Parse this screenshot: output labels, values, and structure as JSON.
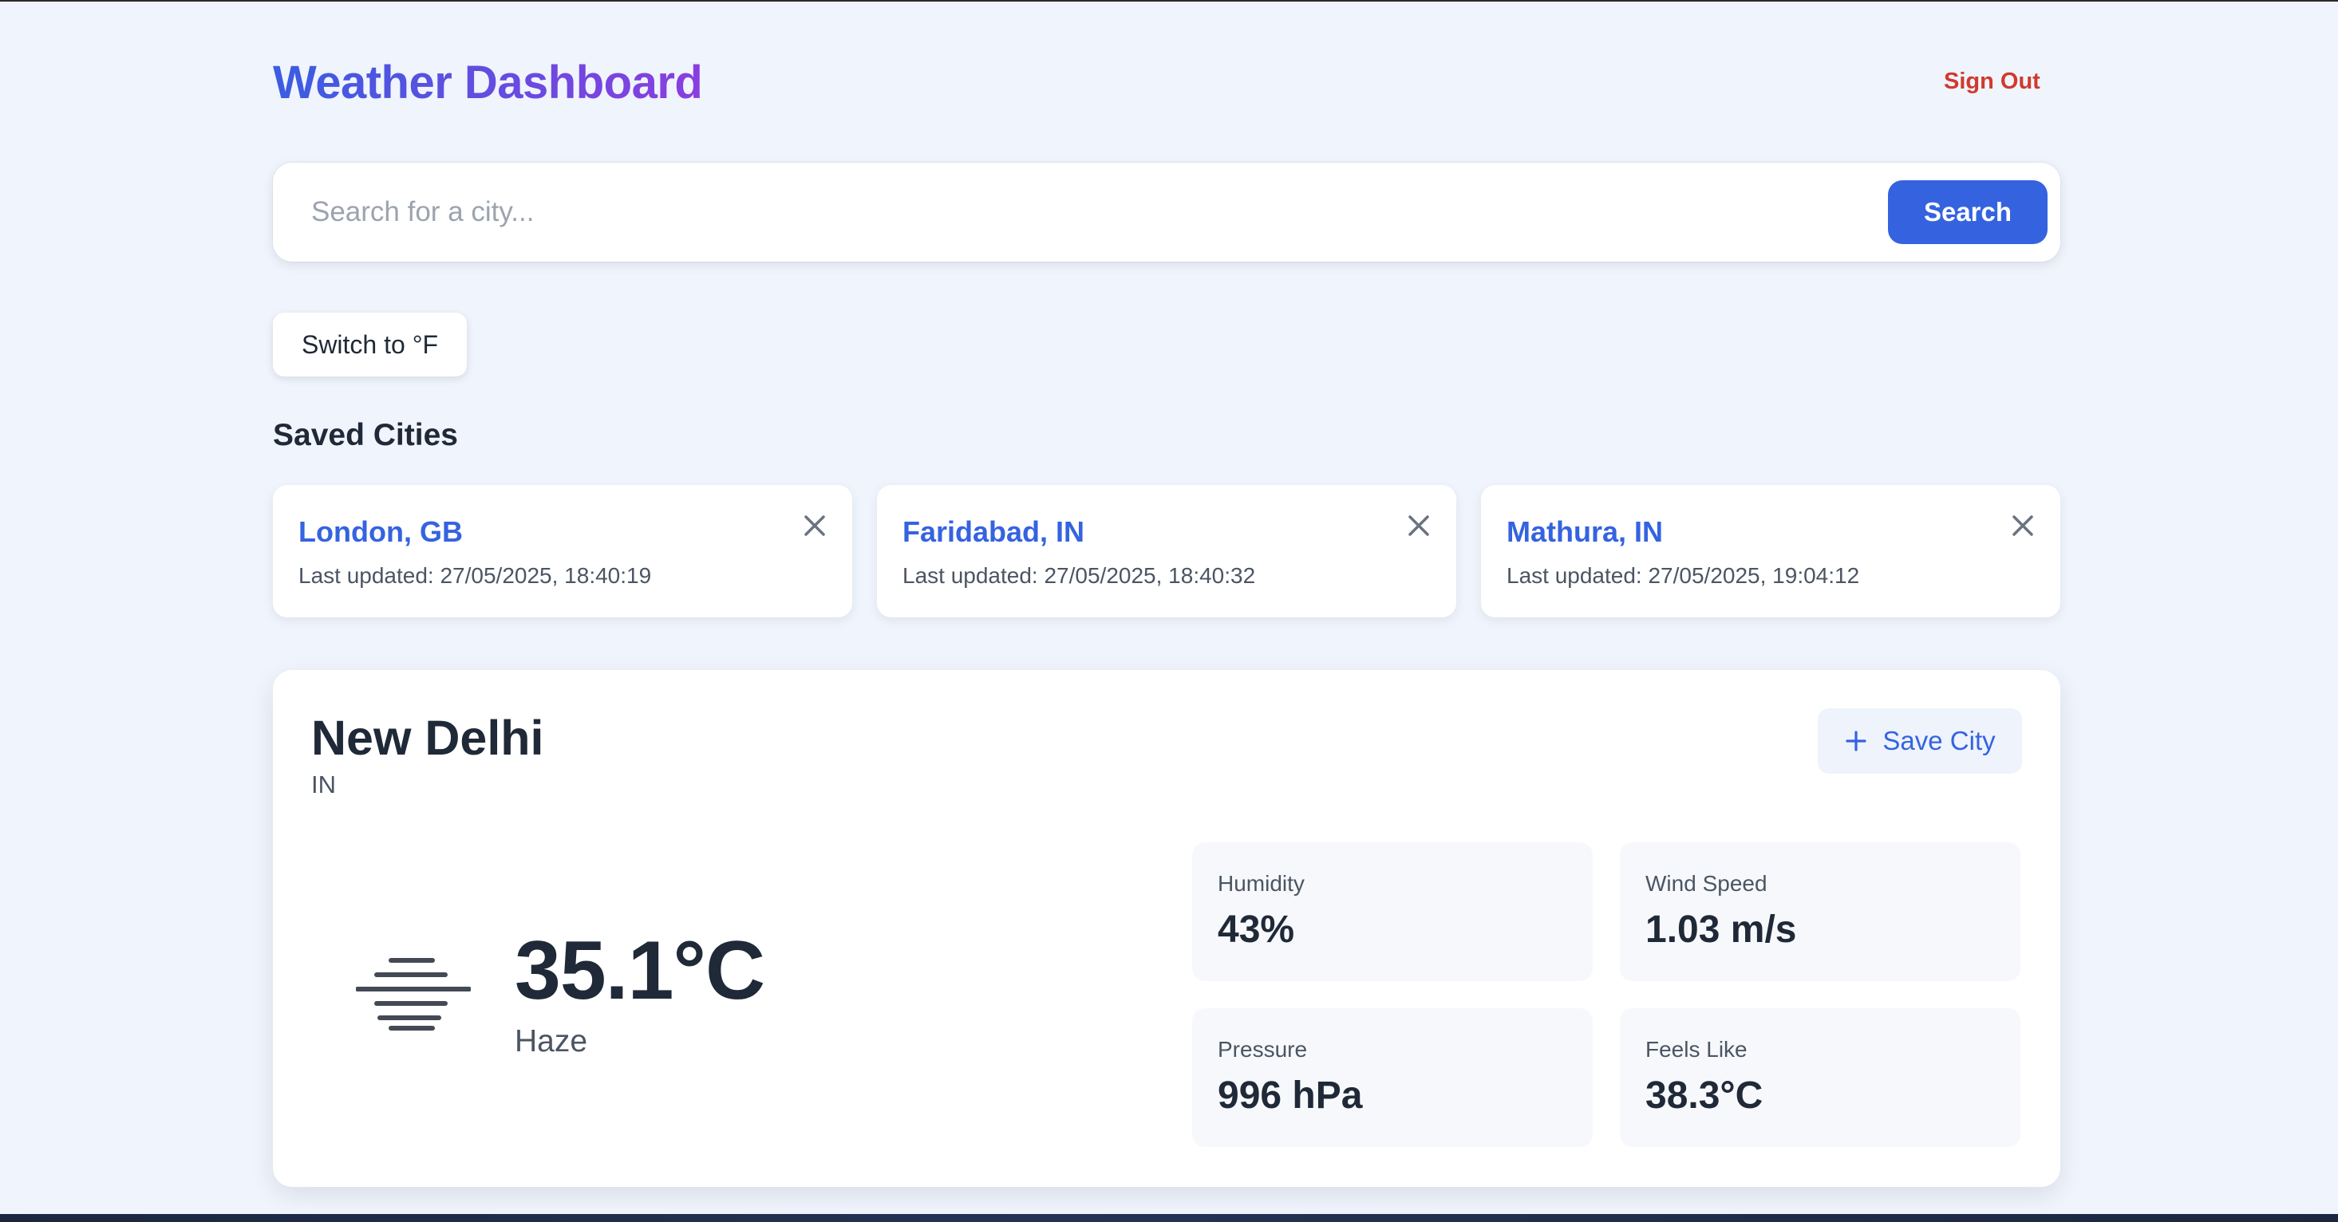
{
  "header": {
    "title": "Weather Dashboard",
    "sign_out_label": "Sign Out"
  },
  "search": {
    "placeholder": "Search for a city...",
    "value": "",
    "button_label": "Search"
  },
  "unit_toggle_label": "Switch to °F",
  "saved": {
    "heading": "Saved Cities",
    "cities": [
      {
        "name": "London, GB",
        "updated": "Last updated: 27/05/2025, 18:40:19"
      },
      {
        "name": "Faridabad, IN",
        "updated": "Last updated: 27/05/2025, 18:40:32"
      },
      {
        "name": "Mathura, IN",
        "updated": "Last updated: 27/05/2025, 19:04:12"
      }
    ]
  },
  "current": {
    "city": "New Delhi",
    "country": "IN",
    "save_label": "Save City",
    "temperature": "35.1°C",
    "condition": "Haze",
    "condition_icon": "haze-icon",
    "stats": {
      "humidity": {
        "label": "Humidity",
        "value": "43%"
      },
      "wind": {
        "label": "Wind Speed",
        "value": "1.03 m/s"
      },
      "pressure": {
        "label": "Pressure",
        "value": "996 hPa"
      },
      "feels_like": {
        "label": "Feels Like",
        "value": "38.3°C"
      }
    }
  },
  "colors": {
    "accent": "#3563e0",
    "title_gradient_start": "#3b5de0",
    "title_gradient_end": "#8a3ee0",
    "sign_out": "#d03a2e",
    "background": "#f0f4fc"
  }
}
